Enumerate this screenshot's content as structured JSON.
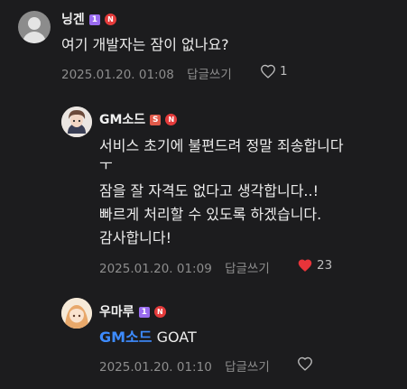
{
  "comments": [
    {
      "author": "닝겐",
      "level_badge": "1",
      "new_badge": "N",
      "lines": [
        "여기 개발자는 잠이 없나요?"
      ],
      "timestamp": "2025.01.20. 01:08",
      "reply_label": "답글쓰기",
      "like_count": "1"
    },
    {
      "author": "GM소드",
      "level_badge": "S",
      "new_badge": "N",
      "lines": [
        "서비스 초기에 불편드려 정말 죄송합니다",
        "ㅜ",
        "잠을 잘 자격도 없다고 생각합니다..!",
        "빠르게 처리할 수 있도록 하겠습니다.",
        "감사합니다!"
      ],
      "timestamp": "2025.01.20. 01:09",
      "reply_label": "답글쓰기",
      "like_count": "23"
    },
    {
      "author": "우마루",
      "level_badge": "1",
      "new_badge": "N",
      "mention": "GM소드",
      "text": "GOAT",
      "timestamp": "2025.01.20. 01:10",
      "reply_label": "답글쓰기"
    }
  ],
  "colors": {
    "background": "#1c1c1e",
    "mention": "#3d8bff",
    "liked_heart": "#e8343a",
    "new_badge": "#e43b3b",
    "level_badge": "#9a6cf0"
  },
  "icons": {
    "default_avatar": "person-silhouette-icon",
    "like_empty": "heart-outline-icon",
    "like_filled": "heart-filled-icon"
  }
}
